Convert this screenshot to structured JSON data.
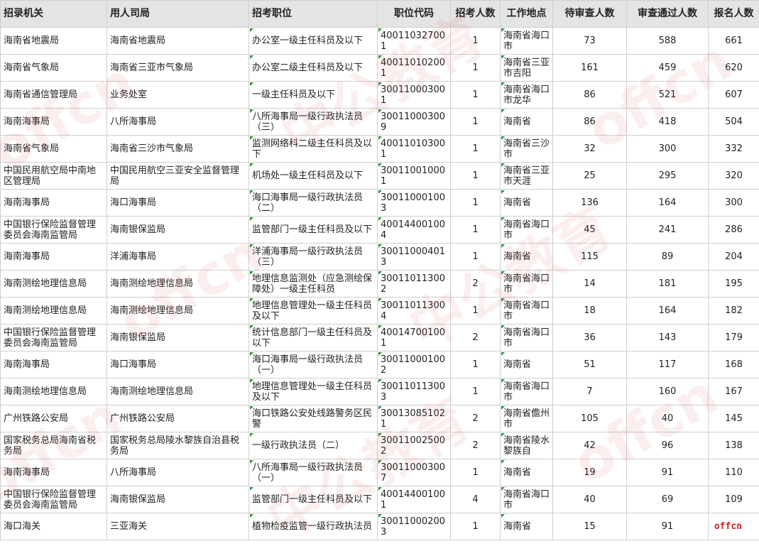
{
  "table": {
    "headers": [
      "招录机关",
      "用人司局",
      "招考职位",
      "职位代码",
      "招考人数",
      "工作地点",
      "待审查人数",
      "审查通过人数",
      "报名人数"
    ],
    "rows": [
      [
        "海南省地震局",
        "海南省地震局",
        "办公室一级主任科员及以下",
        "400110327001",
        "1",
        "海南省海口市",
        "73",
        "588",
        "661"
      ],
      [
        "海南省气象局",
        "海南省三亚市气象局",
        "办公室二级主任科员及以下",
        "400110102001",
        "1",
        "海南省三亚市吉阳",
        "161",
        "459",
        "620"
      ],
      [
        "海南省通信管理局",
        "业务处室",
        "一级主任科员及以下",
        "300110003001",
        "1",
        "海南省海口市龙华",
        "86",
        "521",
        "607"
      ],
      [
        "海南海事局",
        "八所海事局",
        "八所海事局一级行政执法员（三）",
        "300110003009",
        "1",
        "海南省",
        "86",
        "418",
        "504"
      ],
      [
        "海南省气象局",
        "海南省三沙市气象局",
        "监测网络科二级主任科员及以下",
        "400110103001",
        "1",
        "海南省三沙市",
        "32",
        "300",
        "332"
      ],
      [
        "中国民用航空局中南地区管理局",
        "中国民用航空三亚安全监督管理局",
        "机场处一级主任科员及以下",
        "300110010001",
        "1",
        "海南省三亚市天涯",
        "25",
        "295",
        "320"
      ],
      [
        "海南海事局",
        "海口海事局",
        "海口海事局一级行政执法员（二）",
        "300110001003",
        "1",
        "海南省",
        "136",
        "164",
        "300"
      ],
      [
        "中国银行保险监督管理委员会海南监管局",
        "海南银保监局",
        "监管部门一级主任科员及以下",
        "400144001004",
        "1",
        "海南省海口市",
        "45",
        "241",
        "286"
      ],
      [
        "海南海事局",
        "洋浦海事局",
        "洋浦海事局一级行政执法员（三）",
        "300110004013",
        "1",
        "海南省",
        "115",
        "89",
        "204"
      ],
      [
        "海南测绘地理信息局",
        "海南测绘地理信息局",
        "地理信息监测处（应急测绘保障处）一级主任科员",
        "300110113002",
        "2",
        "海南省海口市",
        "14",
        "181",
        "195"
      ],
      [
        "海南测绘地理信息局",
        "海南测绘地理信息局",
        "地理信息管理处一级主任科员及以下",
        "300110113004",
        "1",
        "海南省海口市",
        "18",
        "164",
        "182"
      ],
      [
        "中国银行保险监督管理委员会海南监管局",
        "海南银保监局",
        "统计信息部门一级主任科员及以下",
        "400147001001",
        "2",
        "海南省海口市",
        "36",
        "143",
        "179"
      ],
      [
        "海南海事局",
        "海口海事局",
        "海口海事局一级行政执法员（一）",
        "300110001002",
        "1",
        "海南省",
        "51",
        "117",
        "168"
      ],
      [
        "海南测绘地理信息局",
        "海南测绘地理信息局",
        "地理信息管理处一级主任科员及以下",
        "300110113003",
        "1",
        "海南省海口市",
        "7",
        "160",
        "167"
      ],
      [
        "广州铁路公安局",
        "广州铁路公安局",
        "海口铁路公安处线路警务区民警",
        "300130851021",
        "2",
        "海南省儋州市",
        "105",
        "40",
        "145"
      ],
      [
        "国家税务总局海南省税务局",
        "国家税务总局陵水黎族自治县税务局",
        "一级行政执法员（二）",
        "300110025002",
        "2",
        "海南省陵水黎族自",
        "42",
        "96",
        "138"
      ],
      [
        "海南海事局",
        "八所海事局",
        "八所海事局一级行政执法员（一）",
        "300110003007",
        "1",
        "海南省",
        "19",
        "91",
        "110"
      ],
      [
        "中国银行保险监督管理委员会海南监管局",
        "海南银保监局",
        "监管部门一级主任科员及以下",
        "400144001001",
        "4",
        "海南省海口市",
        "40",
        "69",
        "109"
      ],
      [
        "海口海关",
        "三亚海关",
        "植物检疫监管一级行政执法员",
        "300110002003",
        "1",
        "海南省",
        "15",
        "91",
        "106"
      ]
    ]
  },
  "watermark": {
    "brand_text": "offcn",
    "brand_cn": "中公教育",
    "corner_logo": "offcn",
    "color": "#d64646",
    "code_marker_color": "#2e8b3a"
  }
}
